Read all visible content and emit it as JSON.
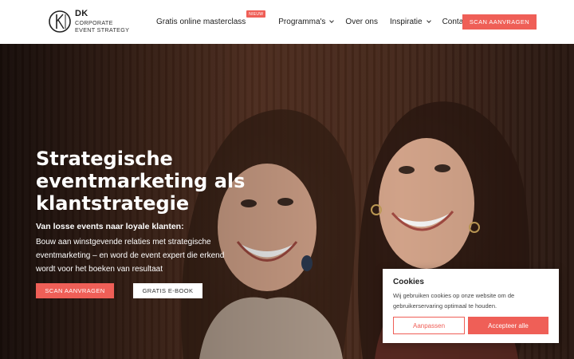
{
  "brand": {
    "mark": "DK",
    "line1": "CORPORATE",
    "line2": "EVENT STRATEGY",
    "accent_color": "#ef5f57"
  },
  "nav": {
    "items": [
      {
        "label": "Gratis online masterclass",
        "badge": "NIEUW"
      },
      {
        "label": "Programma's"
      },
      {
        "label": "Over ons"
      },
      {
        "label": "Inspiratie"
      },
      {
        "label": "Contact"
      }
    ],
    "cta": "SCAN AANVRAGEN"
  },
  "hero": {
    "title": "Strategische eventmarketing als klantstrategie",
    "subtitle_bold": "Van losse events naar loyale klanten:",
    "subtitle": "Bouw aan winstgevende relaties met strategische eventmarketing – en word de event expert die erkend wordt voor het boeken van resultaat",
    "primary_button": "SCAN AANVRAGEN",
    "secondary_button": "GRATIS E-BOOK"
  },
  "cookie": {
    "title": "Cookies",
    "text": "Wij gebruiken cookies op onze website om de gebruikerservaring optimaal te houden.",
    "customize": "Aanpassen",
    "accept": "Accepteer alle"
  }
}
